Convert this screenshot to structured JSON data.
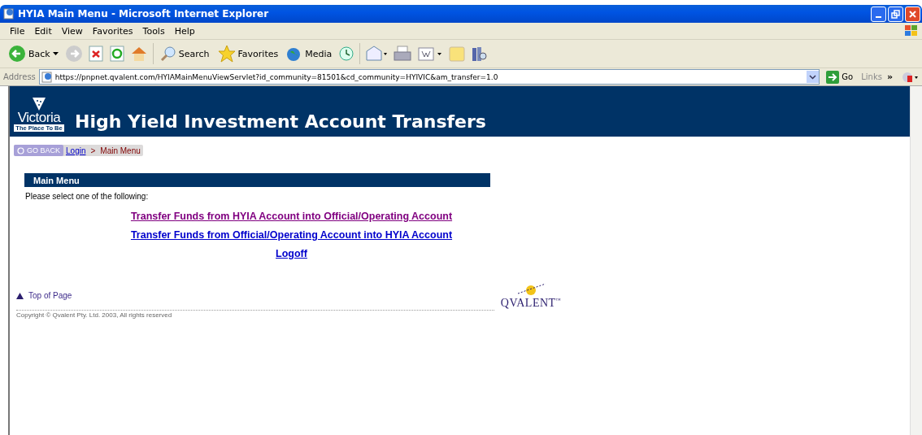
{
  "window": {
    "title": "HYIA Main Menu - Microsoft Internet Explorer"
  },
  "menu": [
    "File",
    "Edit",
    "View",
    "Favorites",
    "Tools",
    "Help"
  ],
  "toolbar": {
    "back": "Back",
    "search": "Search",
    "favorites": "Favorites",
    "media": "Media"
  },
  "address": {
    "label": "Address",
    "url": "https://pnpnet.qvalent.com/HYIAMainMenuViewServlet?id_community=81501&cd_community=HYIVIC&am_transfer=1.0",
    "go": "Go",
    "links": "Links",
    "chevron": "»"
  },
  "banner": {
    "logo_name": "Victoria",
    "logo_tagline": "The Place To Be",
    "title": "High Yield Investment Account Transfers"
  },
  "breadcrumb": {
    "back": "GO BACK",
    "items": [
      {
        "label": "Login",
        "link": true
      },
      {
        "label": ">",
        "link": false
      },
      {
        "label": "Main Menu",
        "link": false
      }
    ]
  },
  "panel": {
    "title": "Main Menu",
    "prompt": "Please select one of the following:"
  },
  "links": [
    {
      "label": "Transfer Funds from HYIA Account into Official/Operating Account",
      "visited": true
    },
    {
      "label": "Transfer Funds from Official/Operating Account into HYIA Account",
      "visited": false
    },
    {
      "label": "Logoff",
      "visited": false
    }
  ],
  "footer": {
    "top": "Top of Page",
    "copyright": "Copyright © Qvalent Pty. Ltd. 2003, All rights reserved",
    "brand": "QVALENT",
    "trademark": "™"
  }
}
